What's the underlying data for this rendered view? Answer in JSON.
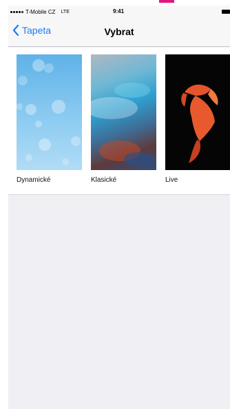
{
  "status_bar": {
    "carrier": "T-Mobile CZ",
    "network": "LTE",
    "time": "9:41"
  },
  "nav": {
    "back_label": "Tapeta",
    "title": "Vybrat"
  },
  "wallpapers": [
    {
      "label": "Dynamické"
    },
    {
      "label": "Klasické"
    },
    {
      "label": "Live"
    }
  ],
  "colors": {
    "accent": "#1a7cf5",
    "background": "#efeff4",
    "top_mark": "#e2167f"
  }
}
